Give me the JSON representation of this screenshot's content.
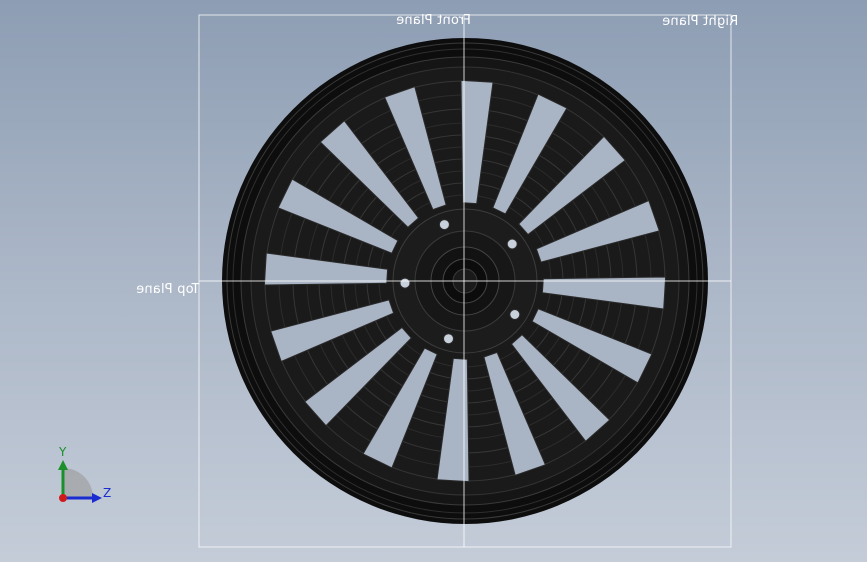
{
  "planes": {
    "front": "Front Plane",
    "right": "Right Plane",
    "top": "Top Plane"
  },
  "triad": {
    "y_label": "Y",
    "z_label": "Z"
  },
  "colors": {
    "wheel_body": "#111111",
    "wheel_line": "#3a3a3a",
    "plane_line": "#ffffff",
    "background_top": "#8d9db3",
    "background_bottom": "#c4ccd8",
    "axis_y": "#1a8f2a",
    "axis_z": "#1a2bd0",
    "axis_x": "#d01a1a"
  },
  "model": {
    "spoke_count": 16,
    "bolt_count": 5
  }
}
